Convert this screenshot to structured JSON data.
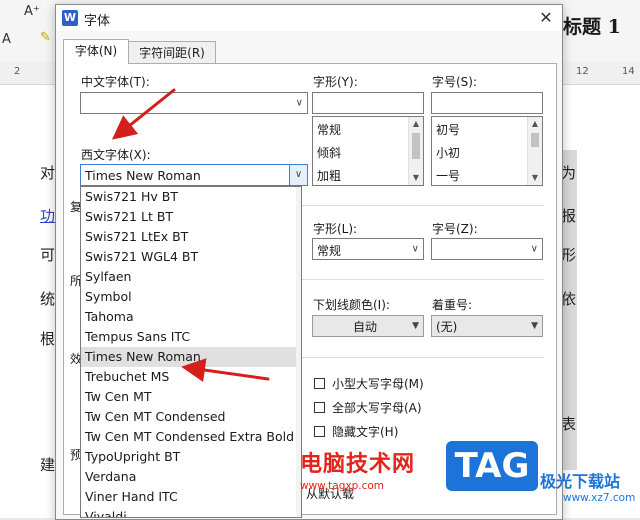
{
  "background": {
    "toolbar": {
      "font_grow": "A⁺",
      "font_format": "A",
      "highlighter": "✎"
    },
    "heading": "标题 1",
    "ruler": {
      "left_num": "2",
      "right_num": "12",
      "right_num2": "14"
    },
    "page_chars_left": [
      "对",
      "功",
      "可",
      "统",
      "根",
      "建",
      "表",
      "重"
    ],
    "page_chars_right": [
      "为",
      "报",
      "形",
      "依",
      "表"
    ]
  },
  "dialog": {
    "app_icon": "W",
    "title": "字体",
    "close": "✕",
    "tabs": [
      {
        "label": "字体(N)"
      },
      {
        "label": "字符间距(R)"
      }
    ],
    "cn_font": {
      "label": "中文字体(T):",
      "value": ""
    },
    "style": {
      "label": "字形(Y):",
      "value": "",
      "options": [
        "常规",
        "倾斜",
        "加粗"
      ]
    },
    "size": {
      "label": "字号(S):",
      "value": "",
      "options": [
        "初号",
        "小初",
        "一号"
      ]
    },
    "western_font": {
      "label": "西文字体(X):",
      "value": "Times New Roman",
      "options": [
        "Swis721 Hv BT",
        "Swis721 Lt BT",
        "Swis721 LtEx BT",
        "Swis721 WGL4 BT",
        "Sylfaen",
        "Symbol",
        "Tahoma",
        "Tempus Sans ITC",
        "Times New Roman",
        "Trebuchet MS",
        "Tw Cen MT",
        "Tw Cen MT Condensed",
        "Tw Cen MT Condensed Extra Bold",
        "TypoUpright BT",
        "Verdana",
        "Viner Hand ITC",
        "Vivaldi"
      ],
      "selected_index": 8
    },
    "complex_label_fragment": "复",
    "other_label_fragment": "所",
    "effects_label_fragment": "效",
    "preview_label_fragment": "预",
    "style2": {
      "label": "字形(L):",
      "value": "常规"
    },
    "size2": {
      "label": "字号(Z):",
      "value": ""
    },
    "underline_color": {
      "label": "下划线颜色(I):",
      "value": "自动"
    },
    "emphasis": {
      "label": "着重号:",
      "value": "(无)"
    },
    "checkboxes": [
      {
        "label": "小型大写字母(M)",
        "checked": false
      },
      {
        "label": "全部大写字母(A)",
        "checked": false
      },
      {
        "label": "隐藏文字(H)",
        "checked": false
      }
    ],
    "bottom_partial": "从默认载"
  },
  "watermark": {
    "title": "电脑技术网",
    "url": "www.tagxp.com",
    "logo": "TAG",
    "site": "极光下载站",
    "site_url": "www.xz7.com"
  },
  "colors": {
    "arrow": "#d4201c",
    "accent": "#2f5fc9",
    "watermark_red": "#e4231b",
    "watermark_blue": "#1d74d8"
  }
}
